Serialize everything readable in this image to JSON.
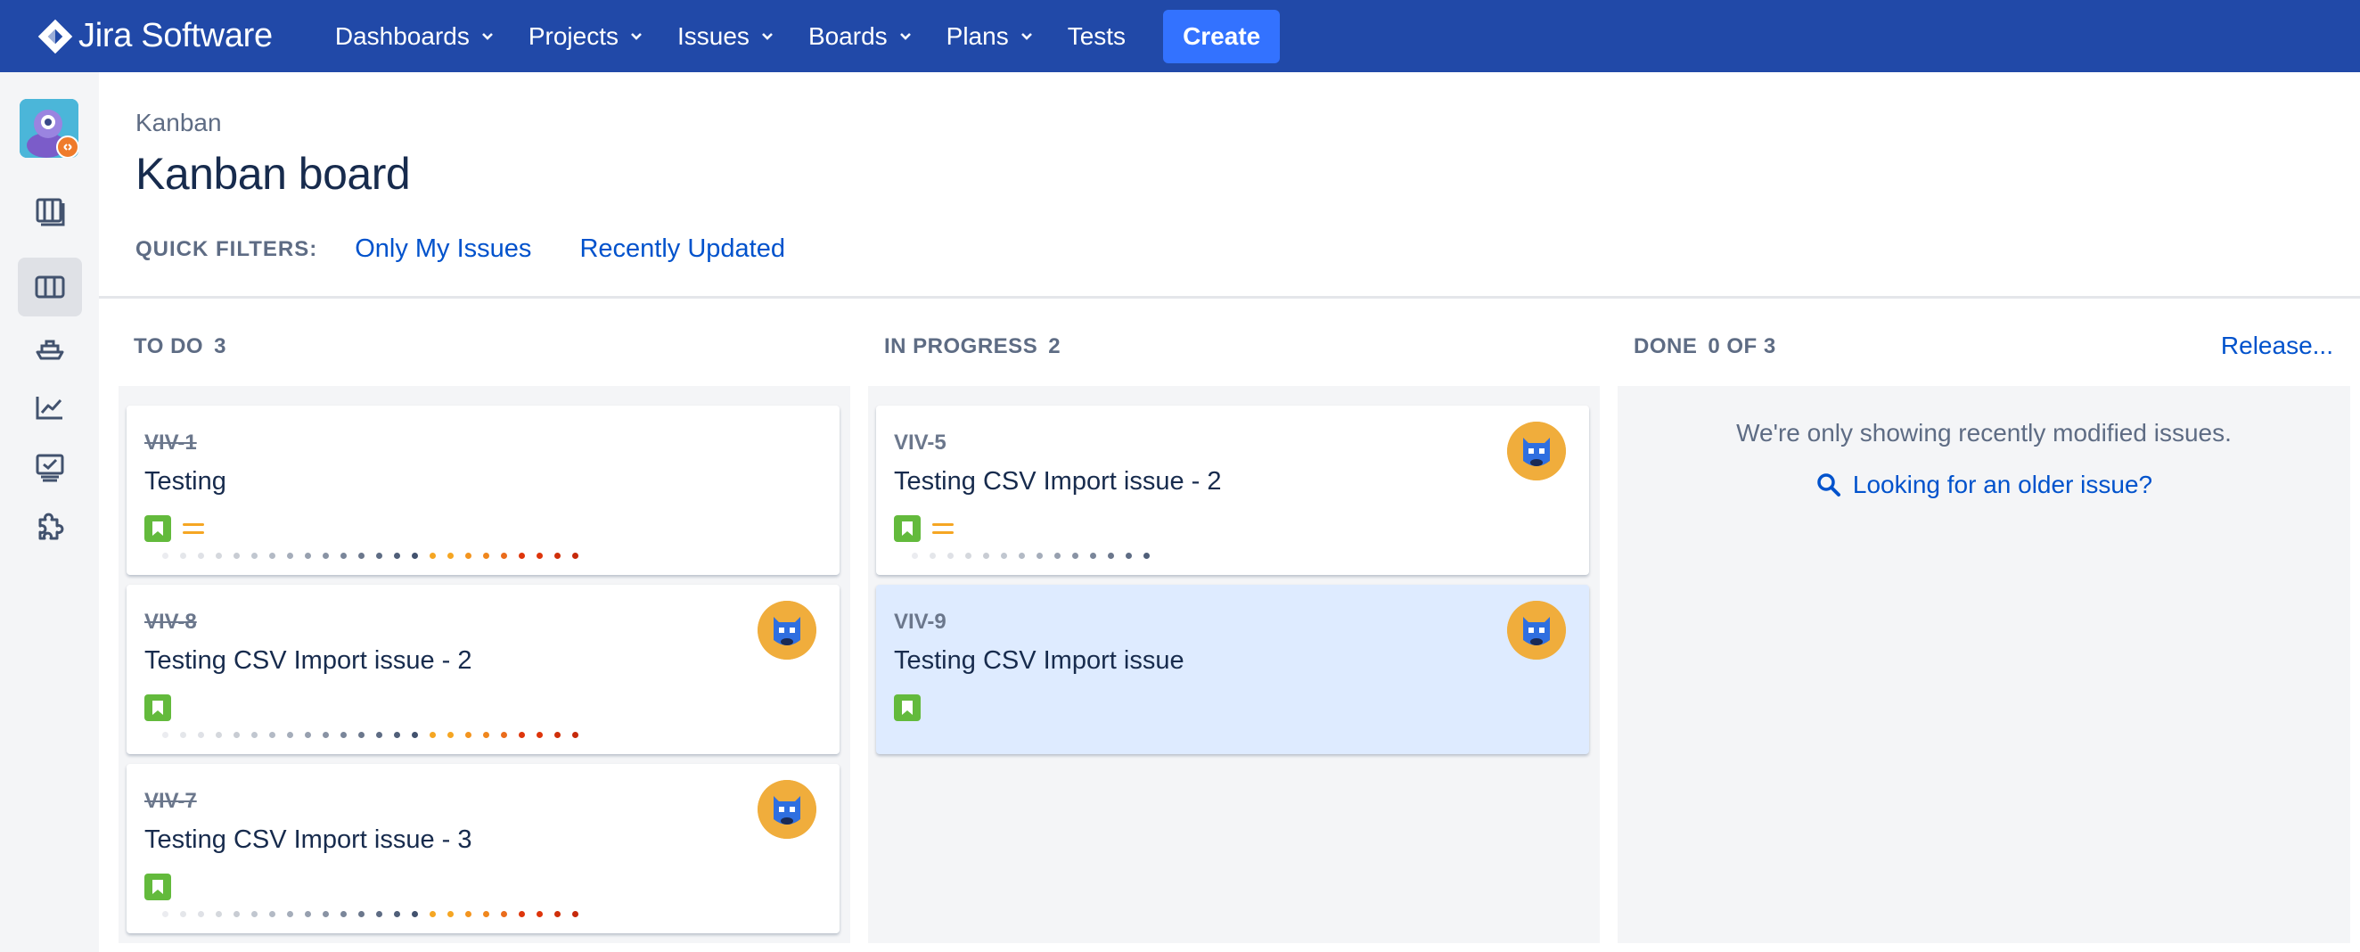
{
  "app": {
    "name": "Jira Software"
  },
  "nav": {
    "items": [
      {
        "label": "Dashboards",
        "dropdown": true
      },
      {
        "label": "Projects",
        "dropdown": true
      },
      {
        "label": "Issues",
        "dropdown": true
      },
      {
        "label": "Boards",
        "dropdown": true
      },
      {
        "label": "Plans",
        "dropdown": true
      },
      {
        "label": "Tests",
        "dropdown": false
      }
    ],
    "create_label": "Create"
  },
  "sidebar": {
    "icons": [
      "project-avatar-icon",
      "backlog-icon",
      "board-icon",
      "releases-icon",
      "reports-icon",
      "test-icon",
      "addons-icon"
    ],
    "active": "board-icon"
  },
  "header": {
    "breadcrumb": "Kanban",
    "title": "Kanban board",
    "quick_filters_label": "QUICK FILTERS:",
    "quick_filters": [
      "Only My Issues",
      "Recently Updated"
    ]
  },
  "columns": {
    "todo": {
      "title": "TO DO",
      "count": "3"
    },
    "in_progress": {
      "title": "IN PROGRESS",
      "count": "2"
    },
    "done": {
      "title": "DONE",
      "count": "0 OF 3",
      "release_label": "Release...",
      "message": "We're only showing recently modified issues.",
      "older_link": "Looking for an older issue?"
    }
  },
  "cards": {
    "todo": [
      {
        "key": "VIV-1",
        "summary": "Testing",
        "resolved": true,
        "type": "story",
        "priority": "medium",
        "assignee": false
      },
      {
        "key": "VIV-8",
        "summary": "Testing CSV Import issue - 2",
        "resolved": true,
        "type": "story",
        "priority": null,
        "assignee": true
      },
      {
        "key": "VIV-7",
        "summary": "Testing CSV Import issue - 3",
        "resolved": true,
        "type": "story",
        "priority": null,
        "assignee": true
      }
    ],
    "in_progress": [
      {
        "key": "VIV-5",
        "summary": "Testing CSV Import issue - 2",
        "resolved": false,
        "type": "story",
        "priority": "medium",
        "assignee": true
      },
      {
        "key": "VIV-9",
        "summary": "Testing CSV Import issue",
        "resolved": false,
        "type": "story",
        "priority": null,
        "assignee": true,
        "selected": true
      }
    ]
  },
  "colors": {
    "nav_bg": "#2149a8",
    "create_btn": "#3372ff",
    "link": "#0052cc",
    "story": "#63ba3c",
    "priority_medium": "#f5a623",
    "avatar_bg": "#f0ad3c",
    "selected_card": "#deebff"
  }
}
